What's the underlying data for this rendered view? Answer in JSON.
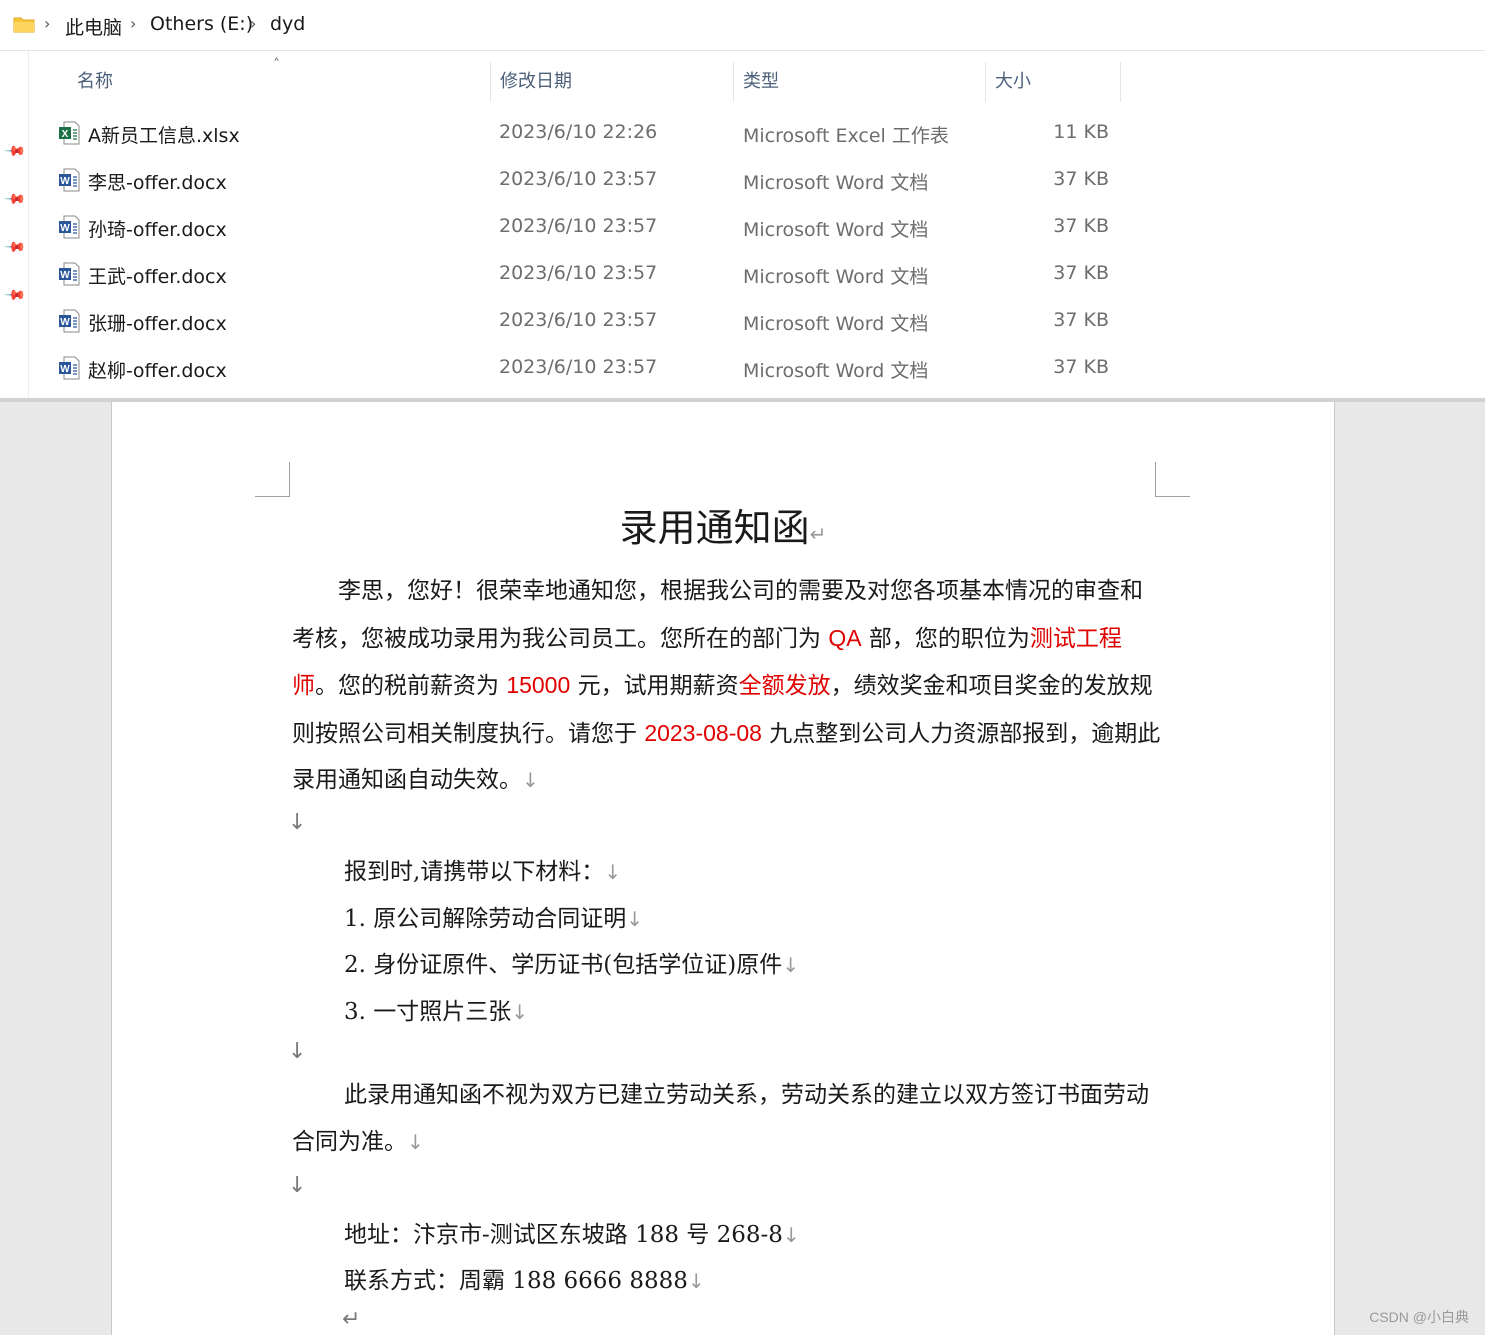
{
  "explorer": {
    "breadcrumb": [
      "此电脑",
      "Others (E:)",
      "dyd"
    ],
    "columns": {
      "name": "名称",
      "modified": "修改日期",
      "type": "类型",
      "size": "大小"
    },
    "files": [
      {
        "name": "A新员工信息.xlsx",
        "modified": "2023/6/10 22:26",
        "type": "Microsoft Excel 工作表",
        "size": "11 KB",
        "icon": "excel-icon"
      },
      {
        "name": "李思-offer.docx",
        "modified": "2023/6/10 23:57",
        "type": "Microsoft Word 文档",
        "size": "37 KB",
        "icon": "word-icon"
      },
      {
        "name": "孙琦-offer.docx",
        "modified": "2023/6/10 23:57",
        "type": "Microsoft Word 文档",
        "size": "37 KB",
        "icon": "word-icon"
      },
      {
        "name": "王武-offer.docx",
        "modified": "2023/6/10 23:57",
        "type": "Microsoft Word 文档",
        "size": "37 KB",
        "icon": "word-icon"
      },
      {
        "name": "张珊-offer.docx",
        "modified": "2023/6/10 23:57",
        "type": "Microsoft Word 文档",
        "size": "37 KB",
        "icon": "word-icon"
      },
      {
        "name": "赵柳-offer.docx",
        "modified": "2023/6/10 23:57",
        "type": "Microsoft Word 文档",
        "size": "37 KB",
        "icon": "word-icon"
      }
    ]
  },
  "document": {
    "title": "录用通知函",
    "p1": {
      "a": "李思，您好！很荣幸地通知您，根据我公司的需要及对您各项基本情况的审查和考核，您被成功录用为我公司员工。您所在的部门为 ",
      "dept": "QA",
      "b": " 部，您的职位为",
      "position": "测试工程师",
      "c": "。您的税前薪资为 ",
      "salary": "15000",
      "d": " 元，试用期薪资",
      "probation": "全额发放",
      "e": "，绩效奖金和项目奖金的发放规则按照公司相关制度执行。请您于 ",
      "date": "2023-08-08",
      "f": " 九点整到公司人力资源部报到，逾期此录用通知函自动失效。"
    },
    "materials_heading": "报到时,请携带以下材料：",
    "materials": [
      "1. 原公司解除劳动合同证明",
      "2. 身份证原件、学历证书(包括学位证)原件",
      "3. 一寸照片三张"
    ],
    "p2": "此录用通知函不视为双方已建立劳动关系，劳动关系的建立以双方签订书面劳动合同为准。",
    "address": "地址：汴京市-测试区东坡路 188 号 268-8",
    "contact": "联系方式：周霸  188 6666 8888"
  },
  "watermark": "CSDN @小白典"
}
